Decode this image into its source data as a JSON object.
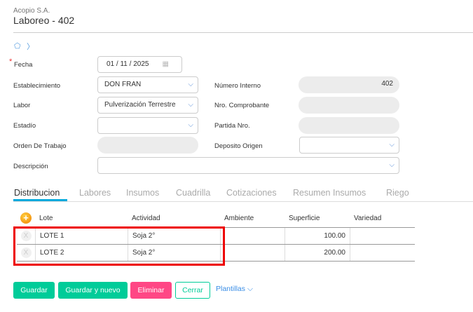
{
  "header": {
    "company": "Acopio S.A.",
    "title": "Laboreo - 402"
  },
  "form": {
    "fecha_label": "Fecha",
    "fecha_day": "01",
    "fecha_month": "11",
    "fecha_year": "2025",
    "establecimiento_label": "Establecimiento",
    "establecimiento_value": "DON FRAN",
    "labor_label": "Labor",
    "labor_value": "Pulverización Terrestre",
    "estadio_label": "Estadío",
    "estadio_value": "",
    "orden_label": "Orden De Trabajo",
    "orden_value": "",
    "descripcion_label": "Descripción",
    "descripcion_value": "",
    "numero_interno_label": "Número Interno",
    "numero_interno_value": "402",
    "comprobante_label": "Nro. Comprobante",
    "comprobante_value": "",
    "partida_label": "Partida Nro.",
    "partida_value": "",
    "deposito_label": "Deposito Origen",
    "deposito_value": ""
  },
  "tabs": [
    "Distribucion",
    "Labores",
    "Insumos",
    "Cuadrilla",
    "Cotizaciones",
    "Resumen Insumos",
    "Riego"
  ],
  "table": {
    "headers": [
      "Lote",
      "Actividad",
      "Ambiente",
      "Superficie",
      "Variedad"
    ],
    "rows": [
      {
        "lote": "LOTE 1",
        "actividad": "Soja 2°",
        "ambiente": "",
        "superficie": "100.00",
        "variedad": ""
      },
      {
        "lote": "LOTE 2",
        "actividad": "Soja 2°",
        "ambiente": "",
        "superficie": "200.00",
        "variedad": ""
      }
    ],
    "remove_label": "X"
  },
  "buttons": {
    "guardar": "Guardar",
    "guardar_nuevo": "Guardar y nuevo",
    "eliminar": "Eliminar",
    "cerrar": "Cerrar",
    "plantillas": "Plantillas"
  },
  "colors": {
    "green": "#00cc99",
    "pink": "#ff4785",
    "accent": "#00aadd",
    "highlight": "#ee0000"
  }
}
